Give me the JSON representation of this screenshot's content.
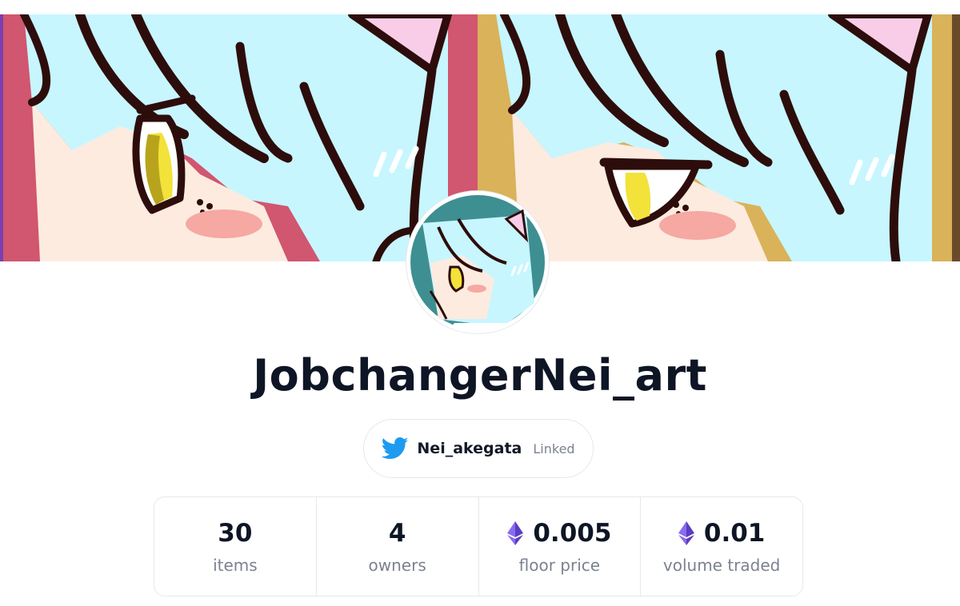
{
  "collection": {
    "name": "JobchangerNei_art"
  },
  "twitter": {
    "icon": "twitter-bird-icon",
    "handle": "Nei_akegata",
    "status": "Linked",
    "brand_color": "#1d9bf0"
  },
  "stats": [
    {
      "value": "30",
      "label": "items",
      "currency_icon": null
    },
    {
      "value": "4",
      "label": "owners",
      "currency_icon": null
    },
    {
      "value": "0.005",
      "label": "floor price",
      "currency_icon": "ethereum-icon"
    },
    {
      "value": "0.01",
      "label": "volume traded",
      "currency_icon": "ethereum-icon"
    }
  ],
  "colors": {
    "banner_left_bg": "#d1566f",
    "banner_right_bg": "#d9b25a",
    "hair": "#c7f6ff",
    "outline": "#2d0d0b",
    "skin": "#fdebe0",
    "eye": "#f2e23a",
    "blush": "#f6a8a2",
    "ear_inner": "#f9cde8",
    "eth_purple": "#6f4fd8",
    "text_primary": "#0e1525",
    "text_secondary": "#7b828f"
  }
}
